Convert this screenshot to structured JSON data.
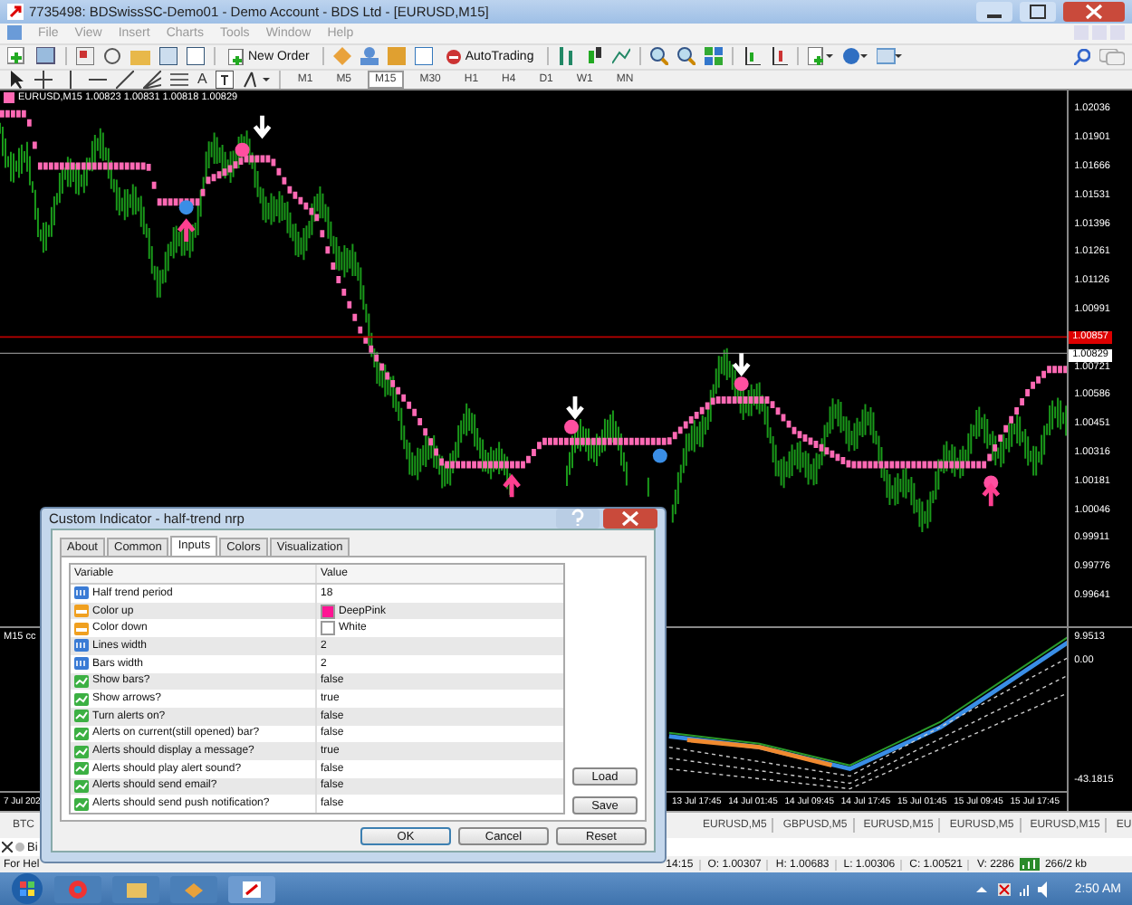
{
  "window": {
    "title": "7735498: BDSwissSC-Demo01 - Demo Account - BDS Ltd - [EURUSD,M15]"
  },
  "menu": [
    "File",
    "View",
    "Insert",
    "Charts",
    "Tools",
    "Window",
    "Help"
  ],
  "toolbar": {
    "new_order": "New Order",
    "auto_trading": "AutoTrading",
    "text_tool": "A"
  },
  "timeframes": [
    {
      "label": "M1",
      "selected": false
    },
    {
      "label": "M5",
      "selected": false
    },
    {
      "label": "M15",
      "selected": true
    },
    {
      "label": "M30",
      "selected": false
    },
    {
      "label": "H1",
      "selected": false
    },
    {
      "label": "H4",
      "selected": false
    },
    {
      "label": "D1",
      "selected": false
    },
    {
      "label": "W1",
      "selected": false
    },
    {
      "label": "MN",
      "selected": false
    }
  ],
  "chart": {
    "info": "EURUSD,M15  1.00823 1.00831 1.00818 1.00829",
    "price_axis": [
      "1.02036",
      "1.01901",
      "1.01666",
      "1.01531",
      "1.01396",
      "1.01261",
      "1.01126",
      "1.00991",
      "1.00721",
      "1.00586",
      "1.00451",
      "1.00316",
      "1.00181",
      "1.00046",
      "0.99911",
      "0.99776",
      "0.99641"
    ],
    "ask_price": "1.00857",
    "bid_price": "1.00829",
    "indicator_label": "M15 cc",
    "indicator_axis": [
      "9.9513",
      "0.00",
      "-43.1815"
    ],
    "time_axis_first": "7 Jul 202",
    "time_axis": [
      "13 Jul 17:45",
      "14 Jul 01:45",
      "14 Jul 09:45",
      "14 Jul 17:45",
      "15 Jul 01:45",
      "15 Jul 09:45",
      "15 Jul 17:45"
    ]
  },
  "chart_tabs_first": "BTC",
  "chart_tabs": [
    "EURUSD,M5",
    "GBPUSD,M5",
    "EURUSD,M15",
    "EURUSD,M5",
    "EURUSD,M15",
    "EU"
  ],
  "terminal_tab": "Bi",
  "status_bar": {
    "help": "For Hel",
    "time": "14:15",
    "fields": [
      "O: 1.00307",
      "H: 1.00683",
      "L: 1.00306",
      "C: 1.00521",
      "V: 2286"
    ],
    "traffic": "266/2 kb"
  },
  "dialog": {
    "title": "Custom Indicator - half-trend nrp",
    "tabs": [
      {
        "label": "About",
        "selected": false
      },
      {
        "label": "Common",
        "selected": false
      },
      {
        "label": "Inputs",
        "selected": true
      },
      {
        "label": "Colors",
        "selected": false
      },
      {
        "label": "Visualization",
        "selected": false
      }
    ],
    "columns": [
      "Variable",
      "Value"
    ],
    "rows": [
      {
        "kind": "int",
        "name": "Half trend period",
        "value": "18"
      },
      {
        "kind": "color",
        "name": "Color up",
        "value": "DeepPink",
        "color": "#ff1493"
      },
      {
        "kind": "color",
        "name": "Color down",
        "value": "White",
        "color": "#ffffff"
      },
      {
        "kind": "int",
        "name": "Lines width",
        "value": "2"
      },
      {
        "kind": "int",
        "name": "Bars width",
        "value": "2"
      },
      {
        "kind": "bool",
        "name": "Show bars?",
        "value": "false"
      },
      {
        "kind": "bool",
        "name": "Show arrows?",
        "value": "true"
      },
      {
        "kind": "bool",
        "name": "Turn alerts on?",
        "value": "false"
      },
      {
        "kind": "bool",
        "name": "Alerts on current(still opened) bar?",
        "value": "false"
      },
      {
        "kind": "bool",
        "name": "Alerts should display a message?",
        "value": "true"
      },
      {
        "kind": "bool",
        "name": "Alerts should play alert sound?",
        "value": "false"
      },
      {
        "kind": "bool",
        "name": "Alerts should send email?",
        "value": "false"
      },
      {
        "kind": "bool",
        "name": "Alerts should send push notification?",
        "value": "false"
      }
    ],
    "side_buttons": [
      "Load",
      "Save"
    ],
    "buttons": [
      "OK",
      "Cancel",
      "Reset"
    ]
  },
  "taskbar": {
    "clock": "2:50 AM"
  }
}
